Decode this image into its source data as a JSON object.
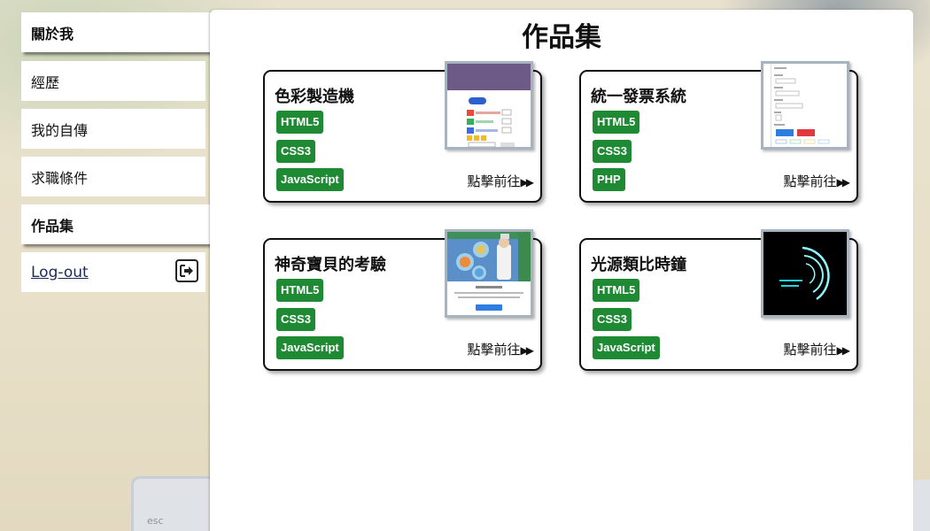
{
  "sidebar": {
    "items": [
      {
        "label": "關於我"
      },
      {
        "label": "經歷"
      },
      {
        "label": "我的自傳"
      },
      {
        "label": "求職條件"
      },
      {
        "label": "作品集"
      }
    ],
    "logout_label": "Log-out"
  },
  "main": {
    "title": "作品集",
    "cards": [
      {
        "title": "色彩製造機",
        "tags": [
          "HTML5",
          "CSS3",
          "JavaScript"
        ],
        "link": "點擊前往"
      },
      {
        "title": "統一發票系統",
        "tags": [
          "HTML5",
          "CSS3",
          "PHP"
        ],
        "link": "點擊前往"
      },
      {
        "title": "神奇寶貝的考驗",
        "tags": [
          "HTML5",
          "CSS3",
          "JavaScript"
        ],
        "link": "點擊前往"
      },
      {
        "title": "光源類比時鐘",
        "tags": [
          "HTML5",
          "CSS3",
          "JavaScript"
        ],
        "link": "點擊前往"
      }
    ]
  },
  "background": {
    "esc_key": "esc"
  },
  "colors": {
    "tag_green": "#1f8a34",
    "thumb_border": "#a7b4c0",
    "logout_link": "#1e2a55"
  },
  "icons": {
    "logout": "sign-out-icon",
    "link_arrow": "double-right-arrow-icon"
  }
}
